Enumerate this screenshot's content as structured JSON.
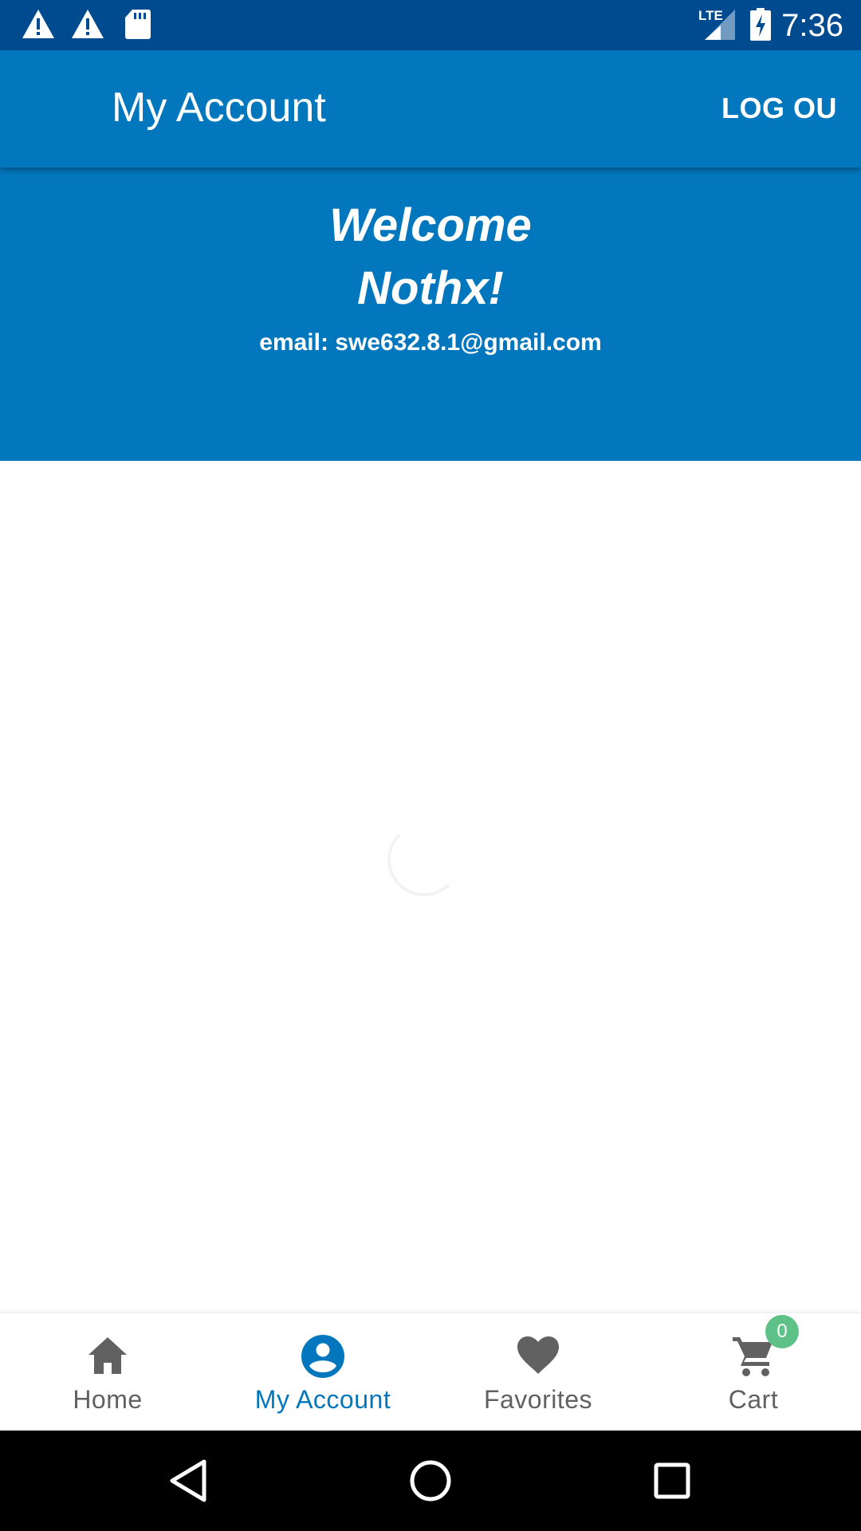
{
  "status_bar": {
    "time": "7:36",
    "network": "LTE",
    "icons": [
      "warning-icon",
      "warning-icon",
      "sd-card-icon",
      "lte-signal-icon",
      "battery-charging-icon"
    ]
  },
  "app_bar": {
    "title": "My Account",
    "logout_label": "LOG OU"
  },
  "welcome": {
    "line1": "Welcome",
    "line2": "Nothx!",
    "email": "email: swe632.8.1@gmail.com"
  },
  "bottom_nav": {
    "items": [
      {
        "label": "Home",
        "icon": "home-icon",
        "active": false
      },
      {
        "label": "My Account",
        "icon": "account-icon",
        "active": true
      },
      {
        "label": "Favorites",
        "icon": "heart-icon",
        "active": false
      },
      {
        "label": "Cart",
        "icon": "cart-icon",
        "active": false
      }
    ],
    "cart_count": "0"
  },
  "colors": {
    "primary": "#0277bd",
    "status_bar": "#004a8f",
    "badge": "#5ec187",
    "nav_inactive": "#616161"
  }
}
